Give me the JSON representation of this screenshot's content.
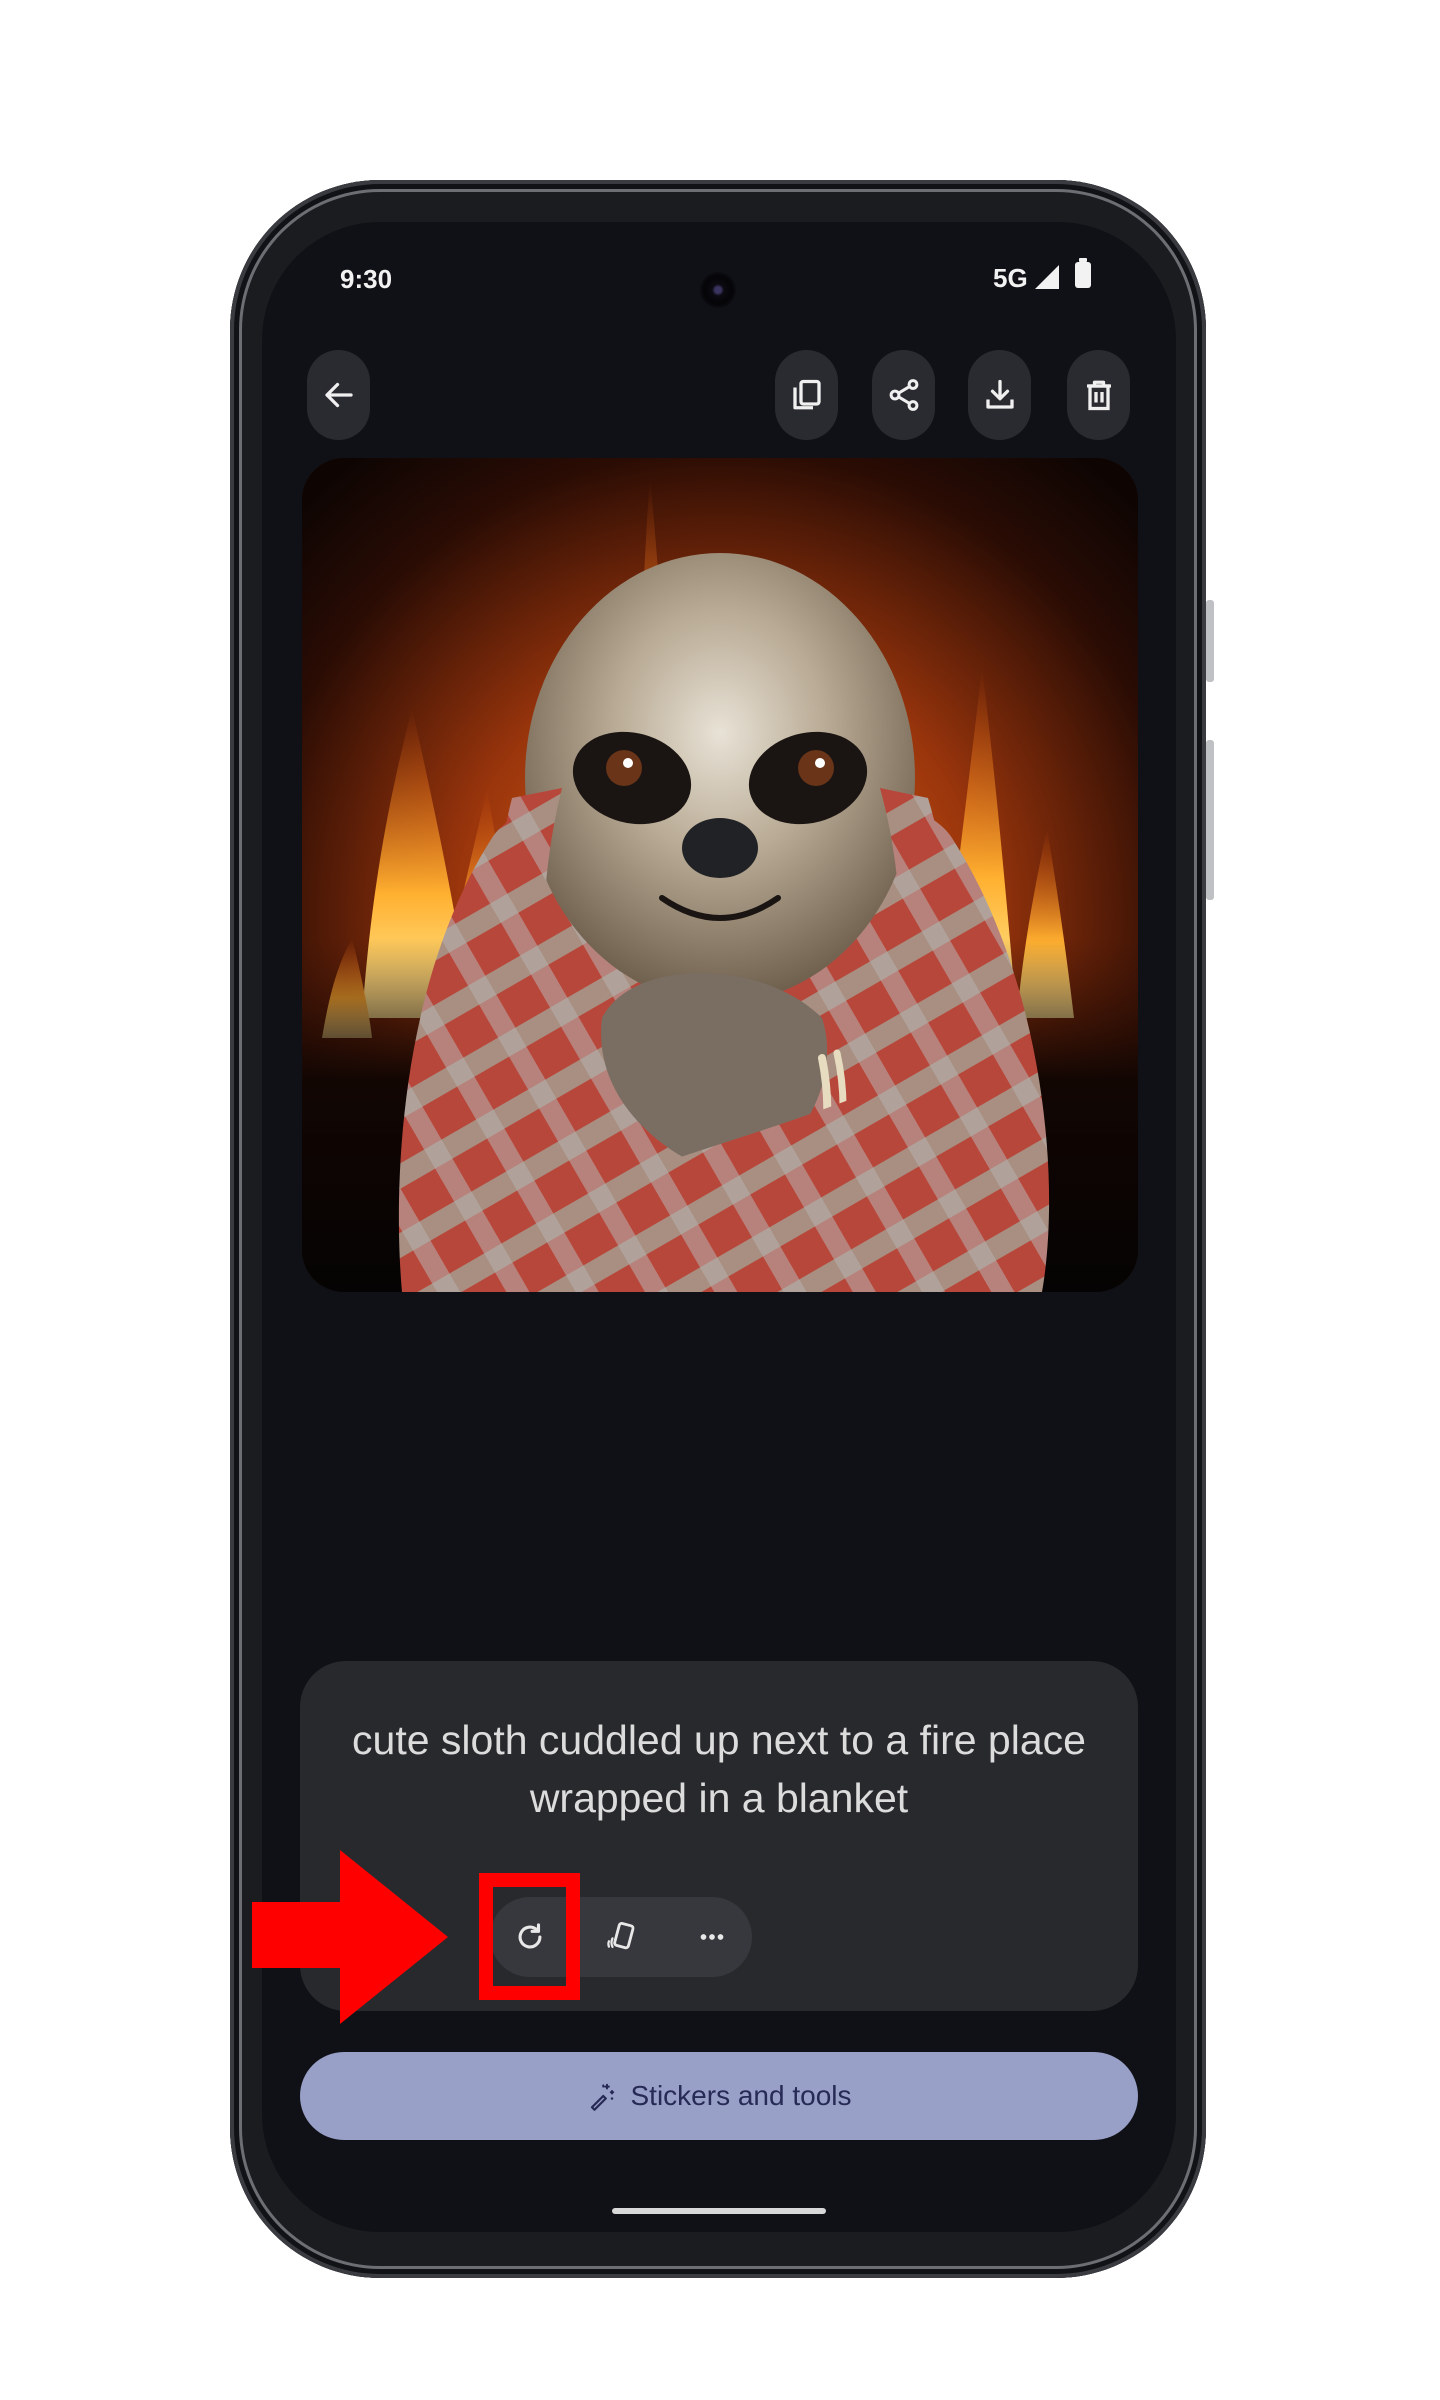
{
  "status_bar": {
    "time": "9:30",
    "network": "5G",
    "signal_icon": "signal-icon",
    "battery_icon": "battery-icon"
  },
  "toolbar": {
    "back_icon": "arrow-left-icon",
    "actions": [
      {
        "name": "copy",
        "icon": "copy-icon"
      },
      {
        "name": "share",
        "icon": "share-icon"
      },
      {
        "name": "download",
        "icon": "download-icon"
      },
      {
        "name": "delete",
        "icon": "trash-icon"
      }
    ]
  },
  "image": {
    "description": "AI-generated sloth wrapped in a red and gray plaid blanket in front of a fireplace"
  },
  "prompt": {
    "text": "cute sloth cuddled up next to a fire place wrapped in a blanket",
    "actions": [
      {
        "name": "regenerate",
        "icon": "refresh-icon"
      },
      {
        "name": "set-wallpaper",
        "icon": "phone-tilt-icon"
      },
      {
        "name": "more",
        "icon": "more-horizontal-icon"
      }
    ]
  },
  "stickers_button": {
    "label": "Stickers and tools",
    "icon": "magic-wand-icon"
  },
  "annotation": {
    "color": "#ff0000",
    "target": "regenerate"
  },
  "colors": {
    "screen_bg": "#101116",
    "card_bg": "#28292d",
    "primary_button": "#98a0c8",
    "primary_button_text": "#262a55"
  }
}
